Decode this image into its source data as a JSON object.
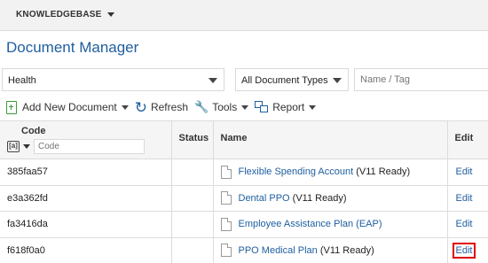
{
  "topbar": {
    "menu_label": "KNOWLEDGEBASE"
  },
  "page": {
    "title": "Document Manager"
  },
  "filters": {
    "category_value": "Health",
    "doc_type_value": "All Document Types",
    "name_tag_placeholder": "Name / Tag"
  },
  "toolbar": {
    "add_label": "Add New Document",
    "refresh_label": "Refresh",
    "tools_label": "Tools",
    "report_label": "Report"
  },
  "table": {
    "columns": {
      "code": "Code",
      "status": "Status",
      "name": "Name",
      "edit": "Edit"
    },
    "code_filter_placeholder": "Code",
    "rows": [
      {
        "code": "385faa57",
        "status": "",
        "name": "Flexible Spending Account",
        "suffix": " (V11 Ready)",
        "edit": "Edit"
      },
      {
        "code": "e3a362fd",
        "status": "",
        "name": "Dental PPO",
        "suffix": " (V11 Ready)",
        "edit": "Edit"
      },
      {
        "code": "fa3416da",
        "status": "",
        "name": "Employee Assistance Plan (EAP)",
        "suffix": "",
        "edit": "Edit"
      },
      {
        "code": "f618f0a0",
        "status": "",
        "name": "PPO Medical Plan",
        "suffix": " (V11 Ready)",
        "edit": "Edit"
      }
    ]
  },
  "colors": {
    "link": "#1f5fa0",
    "highlight": "#e00000",
    "add_icon": "#3a9a3a"
  }
}
